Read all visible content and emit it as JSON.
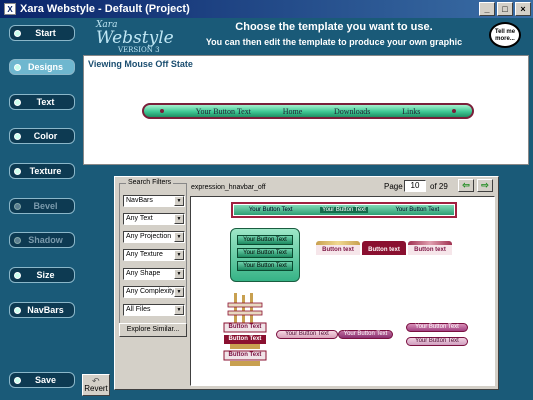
{
  "window": {
    "title": "Xara Webstyle - Default (Project)",
    "minimize": "_",
    "maximize": "□",
    "close": "×"
  },
  "header": {
    "logo_top": "Xara",
    "logo_main": "Webstyle",
    "logo_sub": "VERSION 3",
    "headline": "Choose the template you want to use.",
    "subline": "You can then edit the template to produce your own graphic",
    "tellme": "Tell me more..."
  },
  "sidebar": {
    "items": [
      {
        "label": "Start",
        "state": "normal"
      },
      {
        "label": "Designs",
        "state": "active"
      },
      {
        "label": "Text",
        "state": "normal"
      },
      {
        "label": "Color",
        "state": "normal"
      },
      {
        "label": "Texture",
        "state": "normal"
      },
      {
        "label": "Bevel",
        "state": "disabled"
      },
      {
        "label": "Shadow",
        "state": "disabled"
      },
      {
        "label": "Size",
        "state": "normal"
      },
      {
        "label": "NavBars",
        "state": "normal"
      },
      {
        "label": "Save",
        "state": "normal"
      }
    ]
  },
  "preview": {
    "title": "Viewing Mouse Off State",
    "buttons": [
      "Your Button Text",
      "Home",
      "Downloads",
      "Links"
    ]
  },
  "browser": {
    "filters_label": "Search Filters",
    "filters": [
      "NavBars",
      "Any Text",
      "Any Projection",
      "Any Texture",
      "Any Shape",
      "Any Complexity",
      "All Files"
    ],
    "explore": "Explore Similar...",
    "template_name": "expression_hnavbar_off",
    "page_label": "Page",
    "page_value": "10",
    "of_label": "of 29",
    "prev_arrow": "⇦",
    "next_arrow": "⇨"
  },
  "gallery": {
    "selected_bar": [
      "Your Button Text",
      "Your Button Text",
      "Your Button Text"
    ],
    "green_stack": [
      "Your Button Text",
      "Your Button Text",
      "Your Button Text"
    ],
    "tabs": [
      "Button text",
      "Button text",
      "Button text"
    ],
    "stack_labels": [
      "Button Text",
      "Button Text",
      "Button Text"
    ],
    "pill_row": [
      "Your Button Text",
      "Your Button Text"
    ],
    "pill_stack": [
      "Your Button Text",
      "Your Button Text"
    ]
  },
  "footer": {
    "revert": "Revert"
  }
}
